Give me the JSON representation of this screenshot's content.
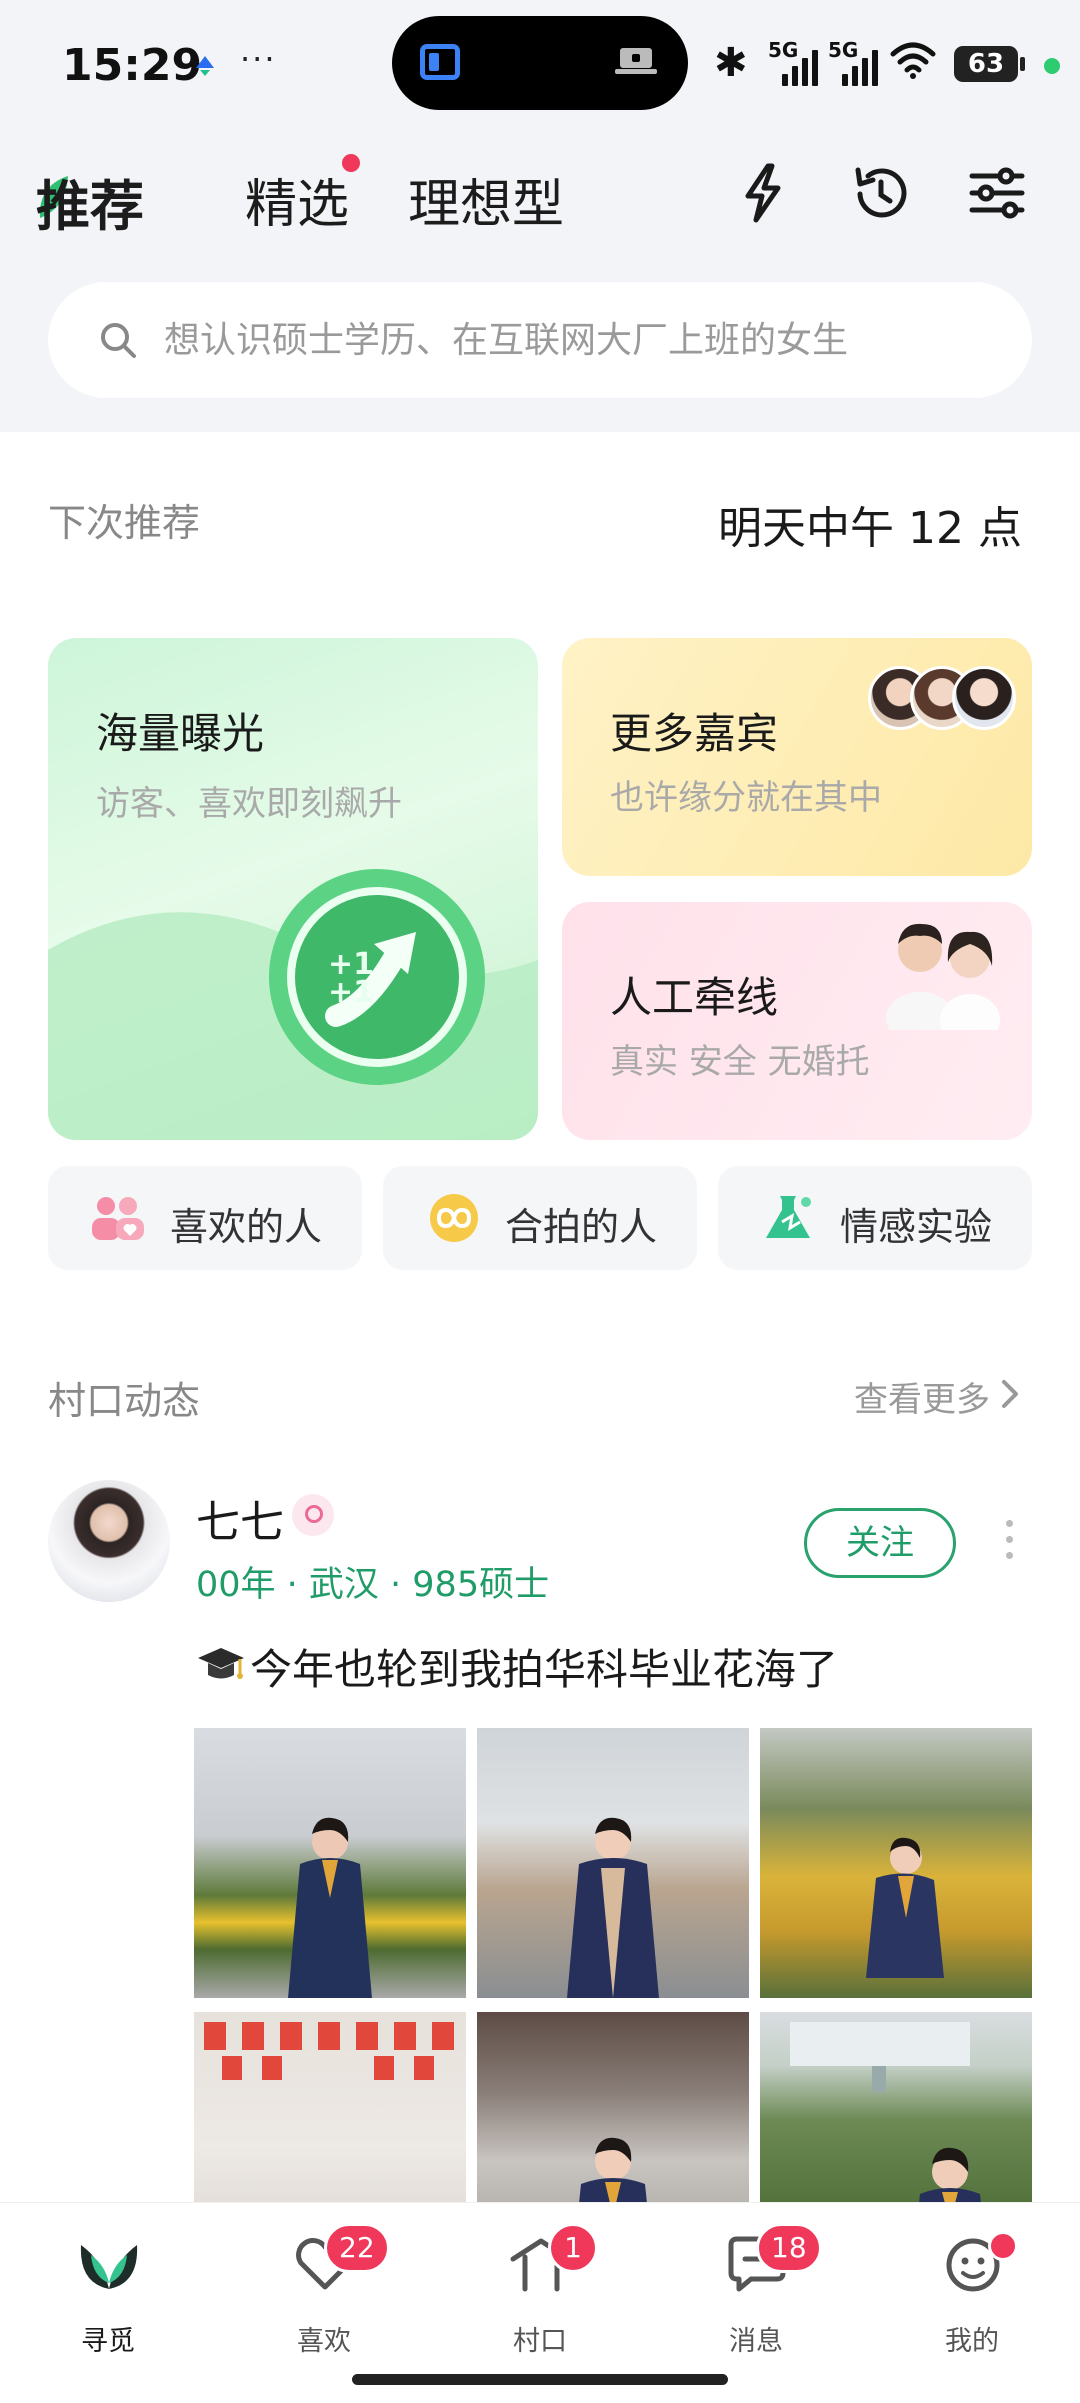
{
  "status_bar": {
    "time": "15:29",
    "dots": "···",
    "signal1_label": "5G",
    "signal2_label": "5G",
    "battery": "63"
  },
  "header": {
    "tabs": [
      {
        "label": "推荐",
        "active": true
      },
      {
        "label": "精选",
        "has_dot": true
      },
      {
        "label": "理想型"
      }
    ],
    "icons": [
      "flash-icon",
      "history-icon",
      "filter-icon"
    ]
  },
  "search": {
    "placeholder": "想认识硕士学历、在互联网大厂上班的女生"
  },
  "next_recommend": {
    "label": "下次推荐",
    "value": "明天中午 12 点"
  },
  "cards": {
    "exposure": {
      "title": "海量曝光",
      "subtitle": "访客、喜欢即刻飙升"
    },
    "guests": {
      "title": "更多嘉宾",
      "subtitle": "也许缘分就在其中"
    },
    "matchmaking": {
      "title": "人工牵线",
      "subtitle": "真实 安全 无婚托"
    }
  },
  "quick_actions": [
    {
      "label": "喜欢的人",
      "icon": "people-heart-icon"
    },
    {
      "label": "合拍的人",
      "icon": "infinity-icon"
    },
    {
      "label": "情感实验",
      "icon": "flask-icon"
    }
  ],
  "feed": {
    "title": "村口动态",
    "more": "查看更多",
    "post": {
      "name": "七七",
      "meta": "00年 · 武汉 · 985硕士",
      "follow_label": "关注",
      "text": "今年也轮到我拍华科毕业花海了",
      "photo_count": 6
    }
  },
  "bottom_nav": [
    {
      "label": "寻觅",
      "active": true
    },
    {
      "label": "喜欢",
      "badge": "22"
    },
    {
      "label": "村口",
      "badge": "1"
    },
    {
      "label": "消息",
      "badge": "18"
    },
    {
      "label": "我的",
      "dot": true
    }
  ],
  "colors": {
    "brand_green": "#1f9c68",
    "badge_red": "#f0385a"
  }
}
